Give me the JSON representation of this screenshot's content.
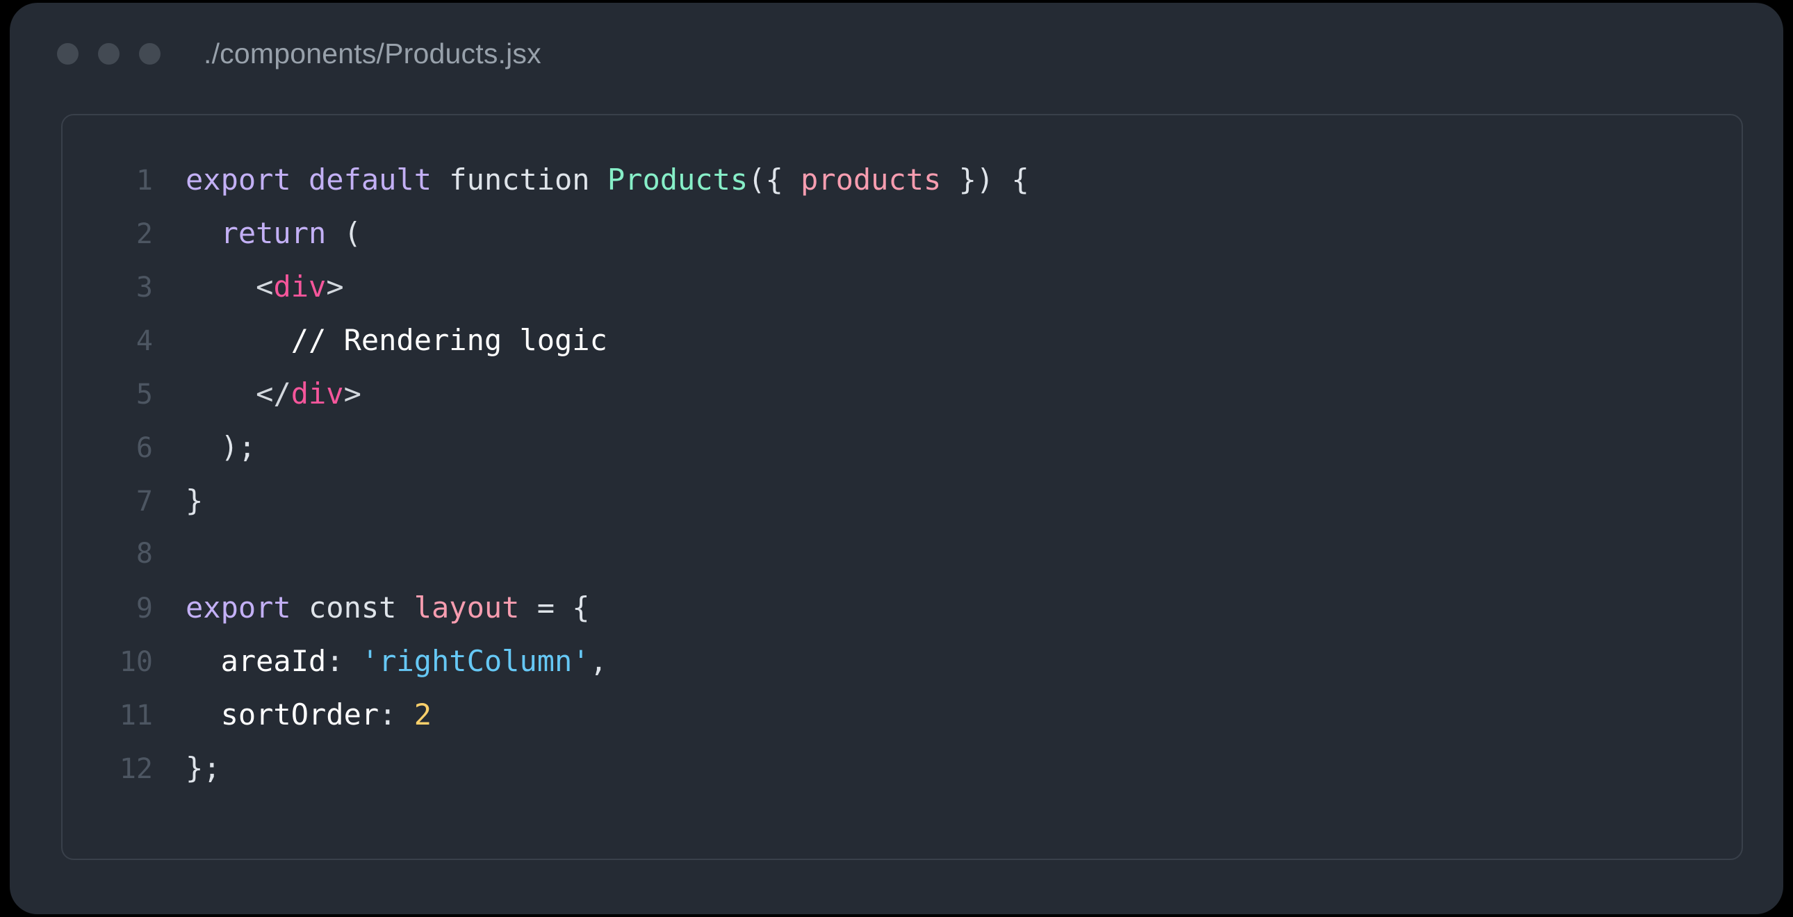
{
  "window": {
    "title": "./components/Products.jsx",
    "traffic_lights": [
      "close-dot",
      "minimize-dot",
      "maximize-dot"
    ],
    "dot_color": "#434a53",
    "background": "#252b34",
    "card_border": "#39404a"
  },
  "editor": {
    "language": "jsx",
    "line_numbers": [
      "1",
      "2",
      "3",
      "4",
      "5",
      "6",
      "7",
      "8",
      "9",
      "10",
      "11",
      "12"
    ],
    "lines": [
      {
        "number": "1",
        "text": "export default function Products({ products }) {",
        "tokens": [
          {
            "text": "export default ",
            "type": "keyword"
          },
          {
            "text": "function ",
            "type": "plain"
          },
          {
            "text": "Products",
            "type": "func"
          },
          {
            "text": "({ ",
            "type": "punct"
          },
          {
            "text": "products",
            "type": "param"
          },
          {
            "text": " }) {",
            "type": "punct"
          }
        ]
      },
      {
        "number": "2",
        "text": "  return (",
        "tokens": [
          {
            "text": "  ",
            "type": "plain"
          },
          {
            "text": "return",
            "type": "keyword"
          },
          {
            "text": " (",
            "type": "punct"
          }
        ]
      },
      {
        "number": "3",
        "text": "    <div>",
        "tokens": [
          {
            "text": "    ",
            "type": "plain"
          },
          {
            "text": "<",
            "type": "bracket"
          },
          {
            "text": "div",
            "type": "tag"
          },
          {
            "text": ">",
            "type": "bracket"
          }
        ]
      },
      {
        "number": "4",
        "text": "      // Rendering logic",
        "tokens": [
          {
            "text": "      ",
            "type": "plain"
          },
          {
            "text": "// Rendering logic",
            "type": "comment"
          }
        ]
      },
      {
        "number": "5",
        "text": "    </div>",
        "tokens": [
          {
            "text": "    ",
            "type": "plain"
          },
          {
            "text": "</",
            "type": "bracket"
          },
          {
            "text": "div",
            "type": "tag"
          },
          {
            "text": ">",
            "type": "bracket"
          }
        ]
      },
      {
        "number": "6",
        "text": "  );",
        "tokens": [
          {
            "text": "  );",
            "type": "punct"
          }
        ]
      },
      {
        "number": "7",
        "text": "}",
        "tokens": [
          {
            "text": "}",
            "type": "punct"
          }
        ]
      },
      {
        "number": "8",
        "text": "",
        "tokens": []
      },
      {
        "number": "9",
        "text": "export const layout = {",
        "tokens": [
          {
            "text": "export ",
            "type": "keyword"
          },
          {
            "text": "const ",
            "type": "plain"
          },
          {
            "text": "layout",
            "type": "var"
          },
          {
            "text": " = {",
            "type": "punct"
          }
        ]
      },
      {
        "number": "10",
        "text": "  areaId: 'rightColumn',",
        "tokens": [
          {
            "text": "  ",
            "type": "plain"
          },
          {
            "text": "areaId",
            "type": "prop"
          },
          {
            "text": ": ",
            "type": "punct"
          },
          {
            "text": "'rightColumn'",
            "type": "string"
          },
          {
            "text": ",",
            "type": "punct"
          }
        ]
      },
      {
        "number": "11",
        "text": "  sortOrder: 2",
        "tokens": [
          {
            "text": "  ",
            "type": "plain"
          },
          {
            "text": "sortOrder",
            "type": "prop"
          },
          {
            "text": ": ",
            "type": "punct"
          },
          {
            "text": "2",
            "type": "number"
          }
        ]
      },
      {
        "number": "12",
        "text": "};",
        "tokens": [
          {
            "text": "};",
            "type": "punct"
          }
        ]
      }
    ]
  },
  "colors": {
    "keyword": "#c3b0f5",
    "function_name": "#87efc8",
    "parameter": "#f79db0",
    "tag": "#f5569b",
    "string": "#66c8f5",
    "number": "#fbd06b",
    "comment": "#ffffff",
    "plain": "#dfe4ea",
    "line_number": "#4d5662",
    "title": "#98a1ab"
  }
}
